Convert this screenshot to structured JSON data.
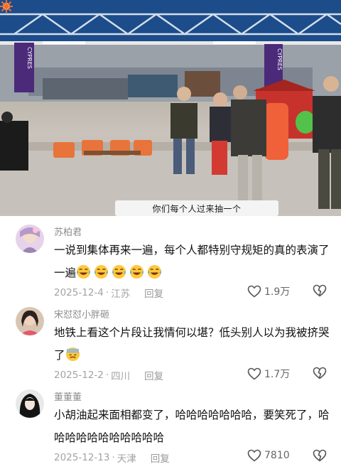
{
  "video": {
    "subtitle": "你们每个人过来抽一个",
    "banner_left": "CYPRES",
    "banner_right": "CYPRES"
  },
  "comments": [
    {
      "username": "苏柏君",
      "text": "一说到集体再来一遍，每个人都特别守规矩的真的表演了一遍",
      "emoji_count": 5,
      "emoji": "laugh-cry-emoji",
      "date": "2025-12-4",
      "location": "江苏",
      "reply": "回复",
      "likes": "1.9万"
    },
    {
      "username": "宋怼怼小胖砸",
      "text": "地铁上看这个片段让我情何以堪？低头别人以为我被挤哭了",
      "emoji_count": 1,
      "emoji": "overwhelmed-emoji",
      "date": "2025-12-2",
      "location": "四川",
      "reply": "回复",
      "likes": "1.7万"
    },
    {
      "username": "董董董",
      "text": "小胡油起来面相都变了，哈哈哈哈哈哈哈，要笑死了，哈哈哈哈哈哈哈哈哈哈哈",
      "emoji_count": 0,
      "date": "2025-12-13",
      "location": "天津",
      "reply": "回复",
      "likes": "7810"
    }
  ],
  "icons": {
    "like": "heart-outline-icon",
    "dislike": "broken-heart-icon"
  },
  "colors": {
    "username": "#8c8c8c",
    "meta": "#a3a3a3",
    "text": "#111111",
    "emoji_yellow": "#ffc83d"
  }
}
